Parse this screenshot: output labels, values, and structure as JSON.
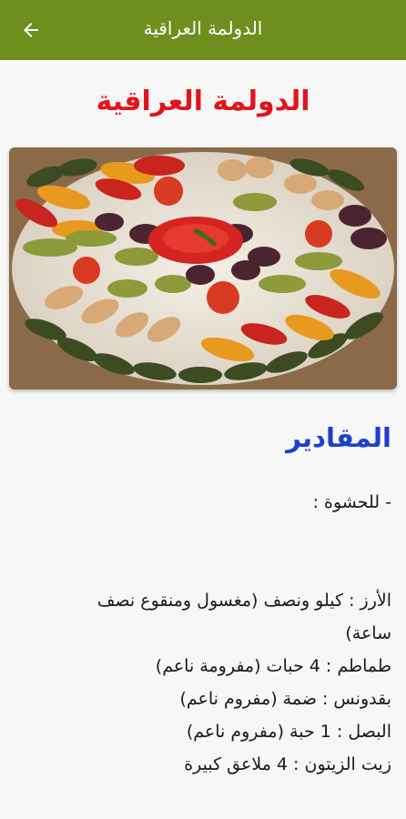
{
  "appbar": {
    "title": "الدولمة العراقية",
    "back_icon": "arrow-left-icon",
    "color": "#6e8f1d"
  },
  "article": {
    "title": "الدولمة العراقية",
    "title_color": "#e2141b",
    "section_title": "المقادير",
    "section_color": "#1a3fd1",
    "lines": [
      "- للحشوة :",
      "",
      "",
      "الأرز : كيلو ونصف (مغسول ومنقوع نصف",
      "ساعة)",
      "طماطم : 4 حبات (مفرومة ناعم)",
      "بقدونس : ضمة (مفروم ناعم)",
      "البصل : 1 حبة (مفروم ناعم)",
      "زيت الزيتون : 4 ملاعق كبيرة"
    ]
  }
}
